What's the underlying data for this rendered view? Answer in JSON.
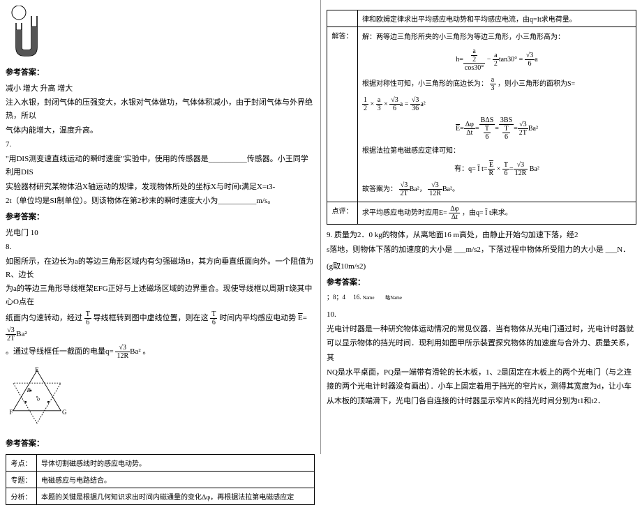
{
  "left": {
    "ans_label": "参考答案：",
    "ans6_line1": "减小  增大    升高   增大",
    "ans6_line2": "注入水银，封闭气体的压强变大，水银对气体做功，气体体积减小，由于封闭气体与外界绝热，所以",
    "ans6_line3": "气体内能增大，温度升高。",
    "q7_num": "7.",
    "q7_line1": "\"用DIS测变速直线运动的瞬时速度\"实验中，使用的传感器是__________传感器。小王同学利用DIS",
    "q7_line2": "实验器材研究某物体沿X轴运动的规律，发现物体所处的坐标X与时间t满足X=t3-",
    "q7_line3": "2t（单位均是SI制单位）。则该物体在第2秒末的瞬时速度大小为__________m/s。",
    "ans7": "光电门        10",
    "q8_num": "8.",
    "q8_line1": "如图所示，在边长为a的等边三角形区域内有匀强磁场B，其方向垂直纸面向外。一个阻值为R、边长",
    "q8_line2": "为a的等边三角形导线框架EFG正好与上述磁场区域的边界重合。现使导线框以周期T绕其中心O点在",
    "q8_line3_a": "纸面内匀速转动，经过",
    "q8_line3_b": "导线框转到图中虚线位置，则在这",
    "q8_line3_c": "时间内平均感应电动势",
    "q8_line4_a": "。通过导线框任一截面的电量q=",
    "q8_line4_b": "。",
    "table": {
      "r1_label": "考点：",
      "r1_text": "导体切割磁感线时的感应电动势。",
      "r2_label": "专题：",
      "r2_text": "电磁感应与电路结合。",
      "r3_label": "分析：",
      "r3_text": "本题的关键是根据几何知识求出时间内磁通量的变化Δφ，再根据法拉第电磁感应定"
    }
  },
  "right": {
    "top_line": "律和欧姆定律求出平均感应电动势和平均感应电流，由q=It求电荷量。",
    "solve_label": "解答：",
    "solve_line1": "解：两等边三角形所夹的小三角形为等边三角形，小三角形高为：",
    "solve_line2_a": "根据对称性可知，小三角形的底边长为：",
    "solve_line2_b": "，则小三角形的面积为S=",
    "solve_line3": "根据法拉第电磁感应定律可知：",
    "solve_line4_a": "有：q=",
    "solve_line5_a": "故答案为：",
    "comment_label": "点评：",
    "comment_text": "求平均感应电动势时应用E=",
    "comment_text2": "，由q=",
    "comment_text3": "t来求。",
    "q9_line1": "9. 质量为2．0 kg的物体，从离地面16 m高处，由静止开始匀加速下落，经2",
    "q9_line2": "s落地，则物体下落的加速度的大小是 ___m/s2，下落过程中物体所受阻力的大小是 ___N．",
    "q9_line3": "(g取10m/s2)",
    "ans_label": "参考答案：",
    "ans9_a": "；8；4",
    "ans9_b": "16.",
    "q10_num": "10.",
    "q10_line1": "光电计时器是一种研究物体运动情况的常见仪器．当有物体从光电门通过时，光电计时器就",
    "q10_line2": "可以显示物体的挡光时间．现利用如图甲所示装置探究物体的加速度与合外力、质量关系，",
    "q10_line3": "其",
    "q10_line4": "NQ是水平桌面，PQ是一端带有滑轮的长木板，1、2是固定在木板上的两个光电门（与之连",
    "q10_line5": "接的两个光电计时器没有画出）．小车上固定着用于挡光的窄片K，测得其宽度为d，让小车",
    "q10_line6": "从木板的顶端滑下，光电门各自连接的计时器显示窄片K的挡光时间分别为t1和t2．"
  }
}
